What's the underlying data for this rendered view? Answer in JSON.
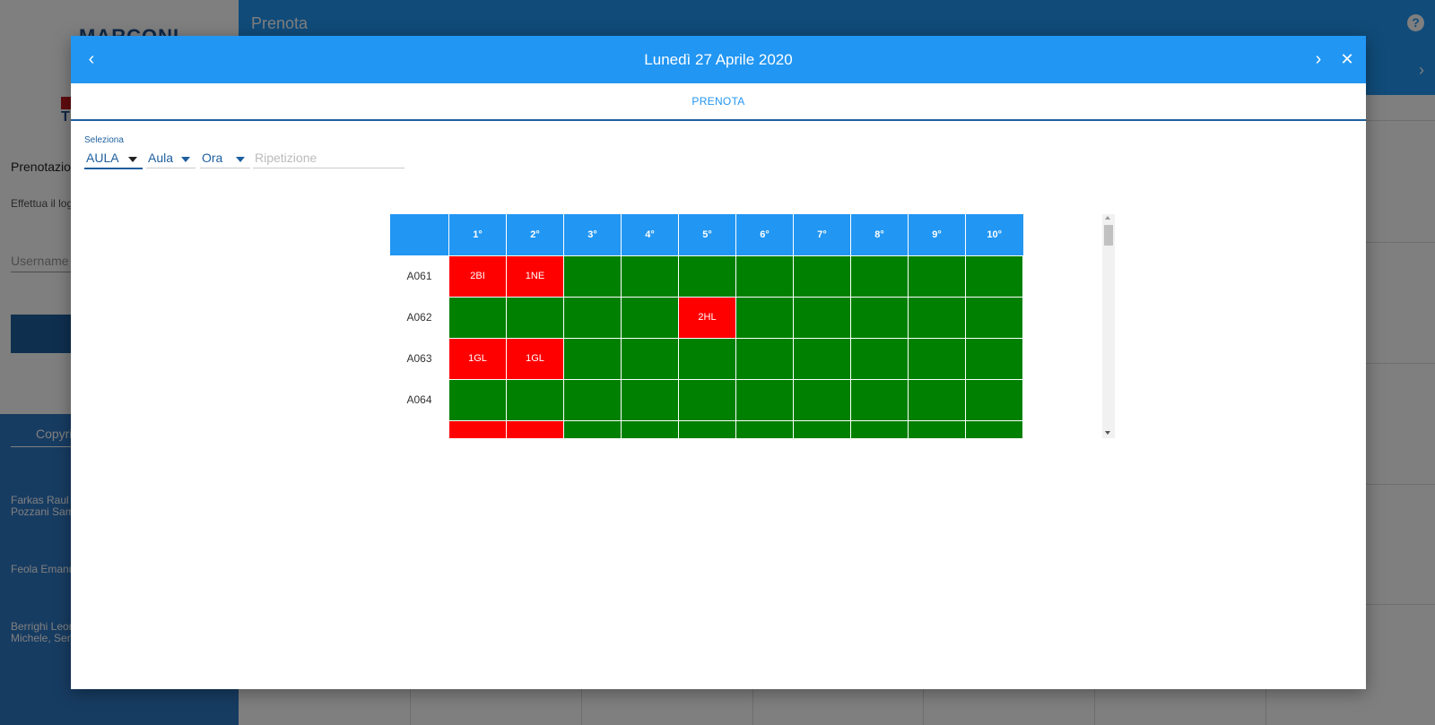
{
  "background": {
    "logo_text": "MARCONI",
    "logo_letter": "T",
    "prenotazioni_label": "Prenotazioni",
    "effettua_label": "Effettua il login",
    "username_placeholder": "Username",
    "copyright_label": "Copyright",
    "credits": [
      "Farkas  Raul\nPozzani Samuele",
      "Feola Emanuele",
      "Berrighi   Leonardo\nMichele, Sergio"
    ],
    "header_title": "Prenota",
    "help_icon": "?",
    "next_arrow": "›"
  },
  "modal": {
    "title": "Lunedì 27 Aprile 2020",
    "prev_icon": "‹",
    "next_icon": "›",
    "close_icon": "✕",
    "tab_label": "PRENOTA",
    "select_label": "Seleziona",
    "selects": {
      "type": "AULA",
      "aula": "Aula",
      "ora": "Ora"
    },
    "repetition_placeholder": "Ripetizione"
  },
  "schedule": {
    "hours": [
      "1°",
      "2°",
      "3°",
      "4°",
      "5°",
      "6°",
      "7°",
      "8°",
      "9°",
      "10°"
    ],
    "rooms": [
      {
        "name": "A061",
        "cells": [
          "2BI",
          "1NE",
          "",
          "",
          "",
          "",
          "",
          "",
          "",
          ""
        ],
        "busy": [
          true,
          true,
          false,
          false,
          false,
          false,
          false,
          false,
          false,
          false
        ]
      },
      {
        "name": "A062",
        "cells": [
          "",
          "",
          "",
          "",
          "2HL",
          "",
          "",
          "",
          "",
          ""
        ],
        "busy": [
          false,
          false,
          false,
          false,
          true,
          false,
          false,
          false,
          false,
          false
        ]
      },
      {
        "name": "A063",
        "cells": [
          "1GL",
          "1GL",
          "",
          "",
          "",
          "",
          "",
          "",
          "",
          ""
        ],
        "busy": [
          true,
          true,
          false,
          false,
          false,
          false,
          false,
          false,
          false,
          false
        ]
      },
      {
        "name": "A064",
        "cells": [
          "",
          "",
          "",
          "",
          "",
          "",
          "",
          "",
          "",
          ""
        ],
        "busy": [
          false,
          false,
          false,
          false,
          false,
          false,
          false,
          false,
          false,
          false
        ]
      },
      {
        "name": "",
        "cells": [
          "",
          "",
          "",
          "",
          "",
          "",
          "",
          "",
          "",
          ""
        ],
        "busy": [
          true,
          true,
          false,
          false,
          false,
          false,
          false,
          false,
          false,
          false
        ]
      }
    ],
    "colors": {
      "free": "#008000",
      "busy": "#ff0000",
      "header": "#2196f3"
    }
  }
}
